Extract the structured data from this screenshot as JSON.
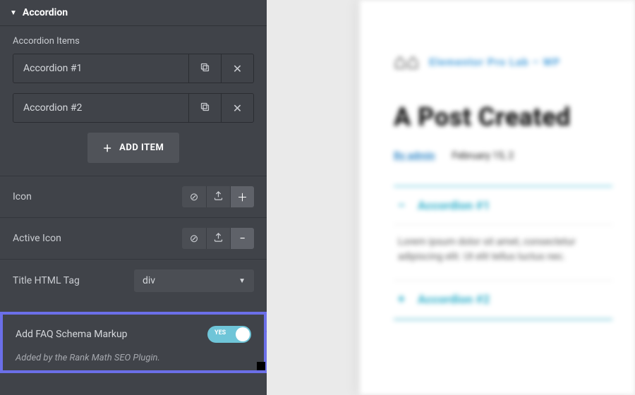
{
  "panel": {
    "section_title": "Accordion",
    "items_label": "Accordion Items",
    "items": [
      {
        "label": "Accordion #1"
      },
      {
        "label": "Accordion #2"
      }
    ],
    "add_item_label": "ADD ITEM",
    "icon_label": "Icon",
    "active_icon_label": "Active Icon",
    "title_tag_label": "Title HTML Tag",
    "title_tag_value": "div",
    "faq": {
      "label": "Add FAQ Schema Markup",
      "toggle_text": "YES",
      "hint": "Added by the Rank Math SEO Plugin."
    },
    "icon_choice_symbols": {
      "none": "⊘",
      "upload": "⤒",
      "plus": "＋",
      "minus": "−"
    }
  },
  "preview": {
    "site_name": "Elementor Pro Lab – WP",
    "post_title": "A Post Created",
    "meta_author": "By admin",
    "meta_date": "February 15, 2",
    "acc1_title": "Accordion #1",
    "acc1_body": "Lorem ipsum dolor sit amet, consectetur adipiscing elit. Ut elit tellus luctus nec.",
    "acc2_title": "Accordion #2"
  }
}
